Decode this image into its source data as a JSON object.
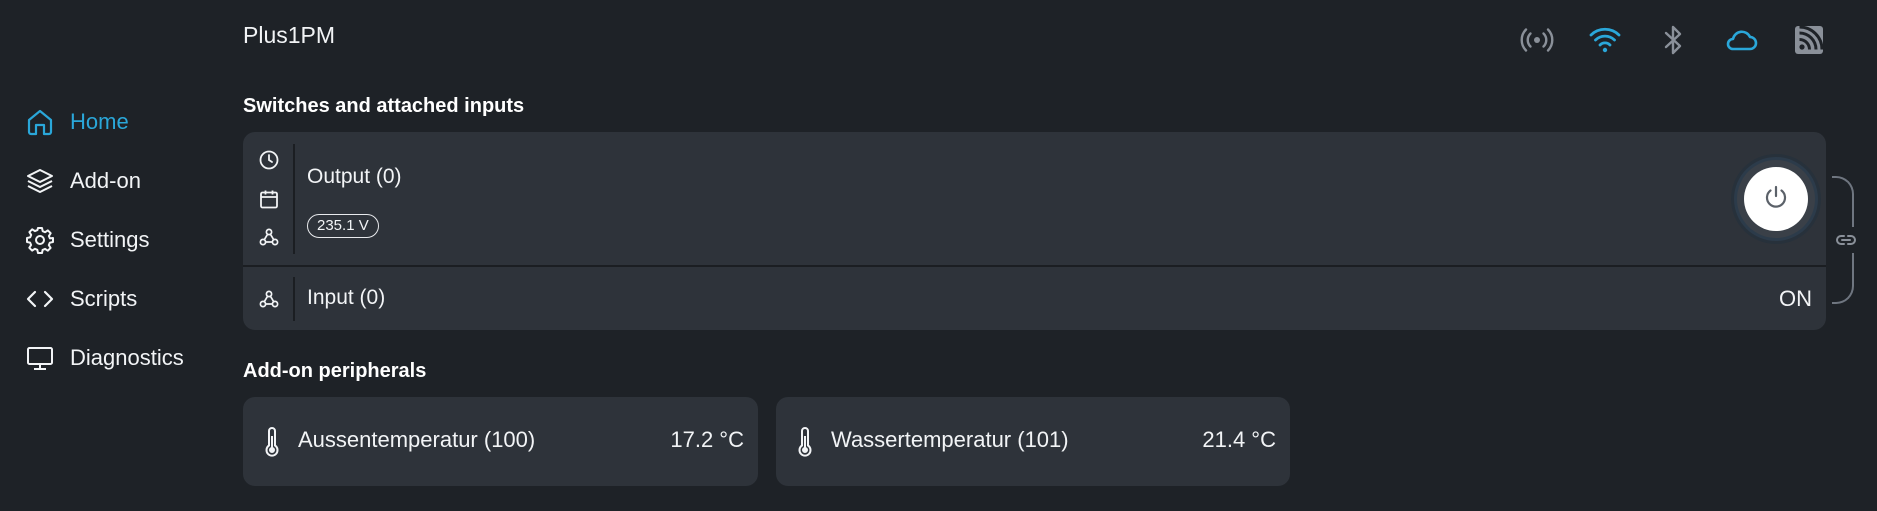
{
  "header": {
    "device_name": "Plus1PM",
    "status_icons": [
      {
        "name": "broadcast-icon",
        "color": "#8a9099"
      },
      {
        "name": "wifi-icon",
        "color": "#2aa7d9"
      },
      {
        "name": "bluetooth-icon",
        "color": "#8a9099"
      },
      {
        "name": "cloud-icon",
        "color": "#2aa7d9"
      },
      {
        "name": "rss-icon",
        "color": "#8a9099"
      }
    ]
  },
  "sidebar": {
    "items": [
      {
        "label": "Home",
        "icon": "home-icon",
        "active": true
      },
      {
        "label": "Add-on",
        "icon": "layers-icon",
        "active": false
      },
      {
        "label": "Settings",
        "icon": "gear-icon",
        "active": false
      },
      {
        "label": "Scripts",
        "icon": "code-icon",
        "active": false
      },
      {
        "label": "Diagnostics",
        "icon": "monitor-icon",
        "active": false
      }
    ]
  },
  "switches": {
    "title": "Switches and attached inputs",
    "output": {
      "name": "Output (0)",
      "voltage": "235.1 V",
      "icons": [
        "clock-icon",
        "calendar-icon",
        "webhook-icon"
      ]
    },
    "input": {
      "name": "Input (0)",
      "state": "ON",
      "icons": [
        "webhook-icon"
      ]
    }
  },
  "addon": {
    "title": "Add-on peripherals",
    "sensors": [
      {
        "name": "Aussentemperatur (100)",
        "value": "17.2 °C"
      },
      {
        "name": "Wassertemperatur (101)",
        "value": "21.4 °C"
      }
    ]
  },
  "colors": {
    "accent": "#2aa7d9",
    "background": "#1e2227",
    "card": "#2e333a"
  }
}
